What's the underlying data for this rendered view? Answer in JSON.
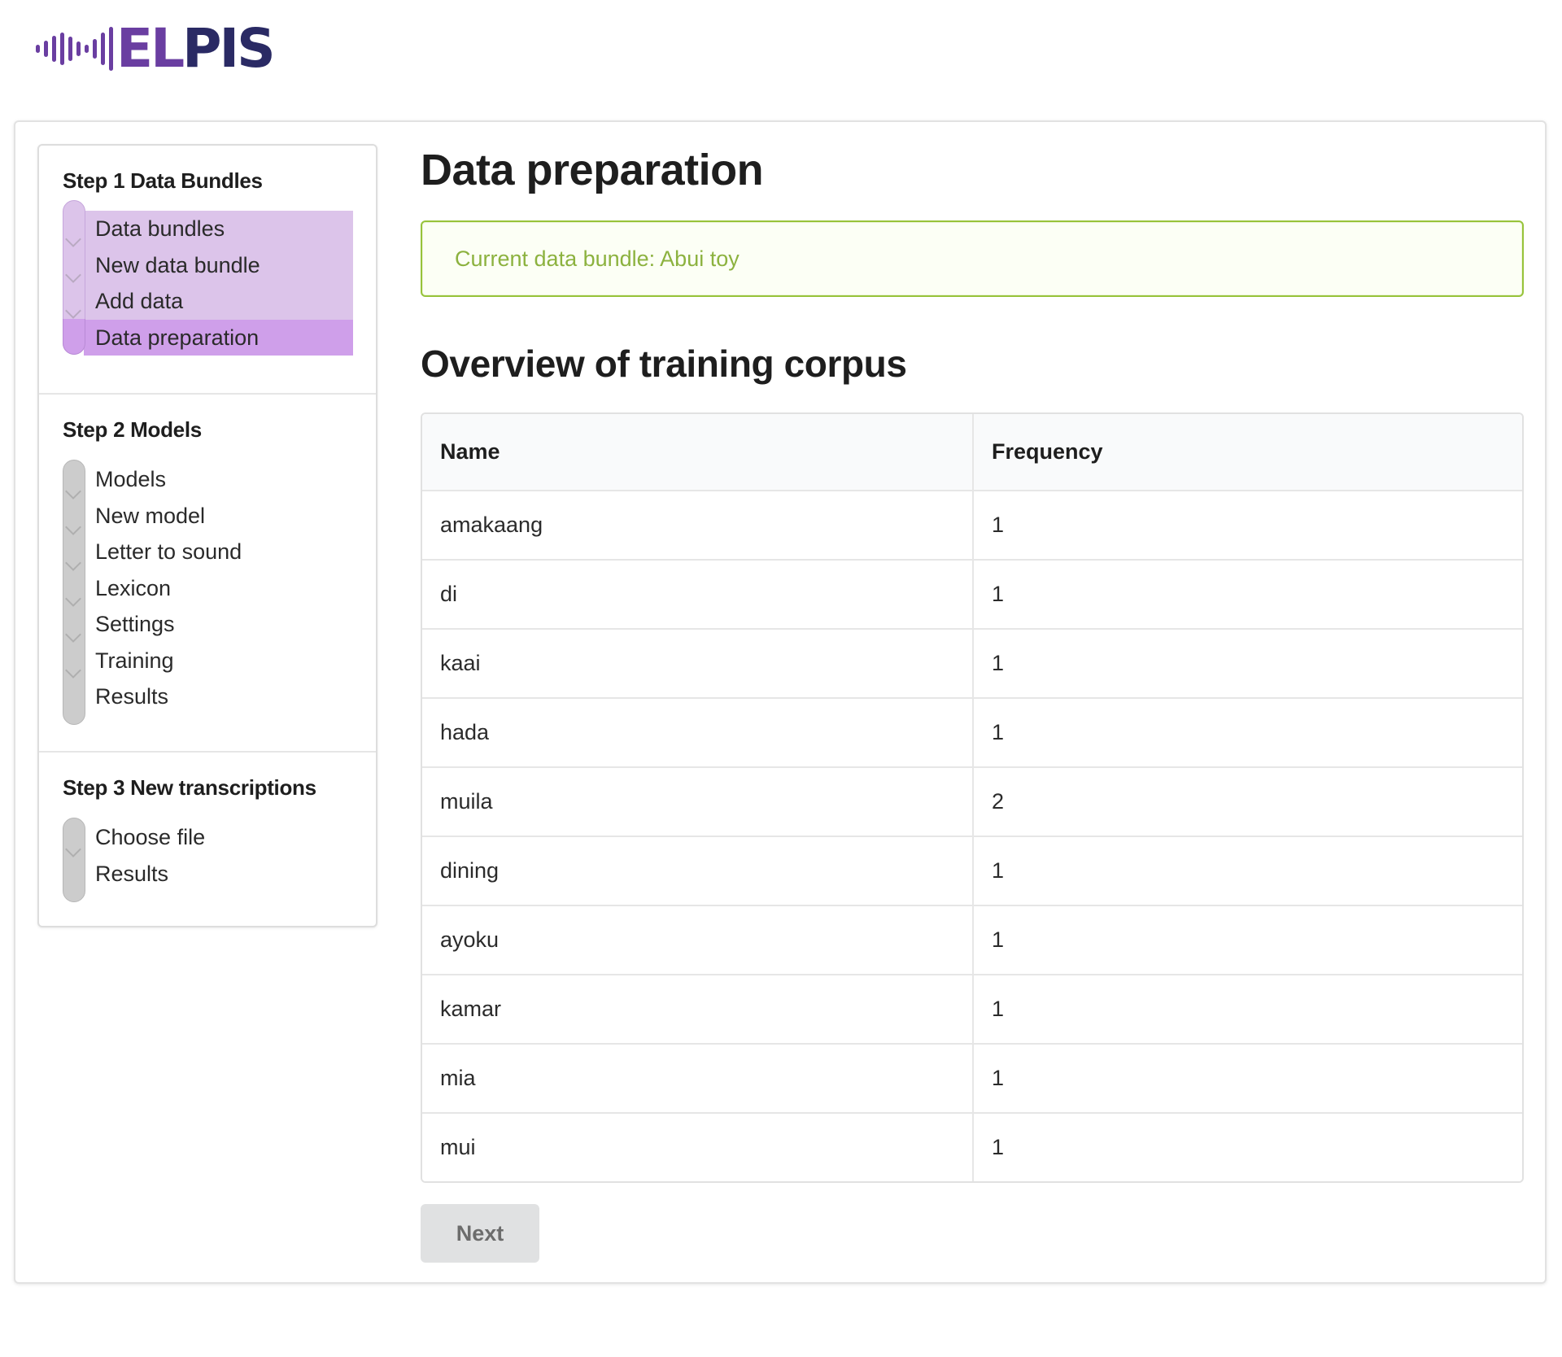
{
  "logo": {
    "text_primary": "EL",
    "text_secondary": "PIS"
  },
  "sidebar": {
    "steps": [
      {
        "title": "Step 1 Data Bundles",
        "items": [
          "Data bundles",
          "New data bundle",
          "Add data",
          "Data preparation"
        ],
        "active_item": "Data preparation"
      },
      {
        "title": "Step 2 Models",
        "items": [
          "Models",
          "New model",
          "Letter to sound",
          "Lexicon",
          "Settings",
          "Training",
          "Results"
        ]
      },
      {
        "title": "Step 3 New transcriptions",
        "items": [
          "Choose file",
          "Results"
        ]
      }
    ]
  },
  "main": {
    "title": "Data preparation",
    "notice": "Current data bundle: Abui toy",
    "section_title": "Overview of training corpus",
    "table": {
      "headers": [
        "Name",
        "Frequency"
      ],
      "rows": [
        [
          "amakaang",
          "1"
        ],
        [
          "di",
          "1"
        ],
        [
          "kaai",
          "1"
        ],
        [
          "hada",
          "1"
        ],
        [
          "muila",
          "2"
        ],
        [
          "dining",
          "1"
        ],
        [
          "ayoku",
          "1"
        ],
        [
          "kamar",
          "1"
        ],
        [
          "mia",
          "1"
        ],
        [
          "mui",
          "1"
        ]
      ]
    },
    "next_label": "Next"
  },
  "colors": {
    "brand_purple": "#6a3ea1",
    "brand_navy": "#2a2a64",
    "step1_track": "#dcc4ea",
    "step1_active": "#cf9fea",
    "notice_border": "#97c33a",
    "notice_text": "#8cb23f"
  }
}
